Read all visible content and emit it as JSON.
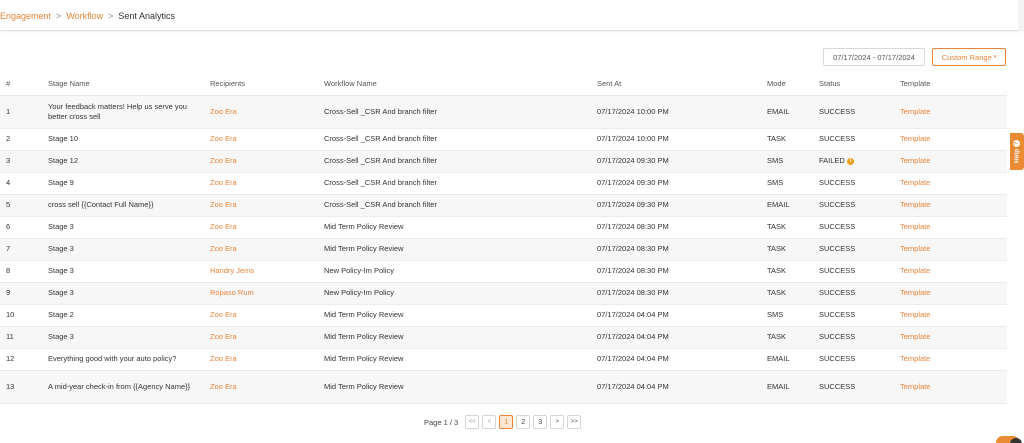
{
  "breadcrumb": {
    "engagement": "Engagement",
    "workflow": "Workflow",
    "current": "Sent Analytics",
    "separator": ">"
  },
  "filters": {
    "date_range": "07/17/2024 - 07/17/2024",
    "custom_range": "Custom Range"
  },
  "help": {
    "label": "Help",
    "icon": "question-icon"
  },
  "table": {
    "columns": [
      "#",
      "Stage Name",
      "Recipients",
      "Workflow Name",
      "Sent At",
      "Mode",
      "Status",
      "Template"
    ],
    "rows": [
      {
        "num": "1",
        "stage": "Your feedback matters! Help us serve you better cross sell",
        "recipient": "Zoo Era",
        "workflow": "Cross-Sell _CSR And branch filter",
        "sent_at": "07/17/2024 10:00 PM",
        "mode": "EMAIL",
        "status": "SUCCESS",
        "template": "Template"
      },
      {
        "num": "2",
        "stage": "Stage 10",
        "recipient": "Zoo Era",
        "workflow": "Cross-Sell _CSR And branch filter",
        "sent_at": "07/17/2024 10:00 PM",
        "mode": "TASK",
        "status": "SUCCESS",
        "template": "Template"
      },
      {
        "num": "3",
        "stage": "Stage 12",
        "recipient": "Zoo Era",
        "workflow": "Cross-Sell _CSR And branch filter",
        "sent_at": "07/17/2024 09:30 PM",
        "mode": "SMS",
        "status": "FAILED",
        "template": "Template"
      },
      {
        "num": "4",
        "stage": "Stage 9",
        "recipient": "Zoo Era",
        "workflow": "Cross-Sell _CSR And branch filter",
        "sent_at": "07/17/2024 09:30 PM",
        "mode": "SMS",
        "status": "SUCCESS",
        "template": "Template"
      },
      {
        "num": "5",
        "stage": "cross sell {{Contact Full Name}}",
        "recipient": "Zoo Era",
        "workflow": "Cross-Sell _CSR And branch filter",
        "sent_at": "07/17/2024 09:30 PM",
        "mode": "EMAIL",
        "status": "SUCCESS",
        "template": "Template"
      },
      {
        "num": "6",
        "stage": "Stage 3",
        "recipient": "Zoo Era",
        "workflow": "Mid Term Policy Review",
        "sent_at": "07/17/2024 08:30 PM",
        "mode": "TASK",
        "status": "SUCCESS",
        "template": "Template"
      },
      {
        "num": "7",
        "stage": "Stage 3",
        "recipient": "Zoo Era",
        "workflow": "Mid Term Policy Review",
        "sent_at": "07/17/2024 08:30 PM",
        "mode": "TASK",
        "status": "SUCCESS",
        "template": "Template"
      },
      {
        "num": "8",
        "stage": "Stage 3",
        "recipient": "Handry Jems",
        "workflow": "New Policy-Im Policy",
        "sent_at": "07/17/2024 08:30 PM",
        "mode": "TASK",
        "status": "SUCCESS",
        "template": "Template"
      },
      {
        "num": "9",
        "stage": "Stage 3",
        "recipient": "Ropaso Rum",
        "workflow": "New Policy-Im Policy",
        "sent_at": "07/17/2024 08:30 PM",
        "mode": "TASK",
        "status": "SUCCESS",
        "template": "Template"
      },
      {
        "num": "10",
        "stage": "Stage 2",
        "recipient": "Zoo Era",
        "workflow": "Mid Term Policy Review",
        "sent_at": "07/17/2024 04:04 PM",
        "mode": "SMS",
        "status": "SUCCESS",
        "template": "Template"
      },
      {
        "num": "11",
        "stage": "Stage 3",
        "recipient": "Zoo Era",
        "workflow": "Mid Term Policy Review",
        "sent_at": "07/17/2024 04:04 PM",
        "mode": "TASK",
        "status": "SUCCESS",
        "template": "Template"
      },
      {
        "num": "12",
        "stage": "Everything good with your auto policy?",
        "recipient": "Zoo Era",
        "workflow": "Mid Term Policy Review",
        "sent_at": "07/17/2024 04:04 PM",
        "mode": "EMAIL",
        "status": "SUCCESS",
        "template": "Template"
      },
      {
        "num": "13",
        "stage": "A mid-year check-in from {{Agency Name}}",
        "recipient": "Zoo Era",
        "workflow": "Mid Term Policy Review",
        "sent_at": "07/17/2024 04:04 PM",
        "mode": "EMAIL",
        "status": "SUCCESS",
        "template": "Template"
      }
    ]
  },
  "pagination": {
    "label": "Page 1 / 3",
    "first": "<<",
    "prev": "<",
    "pages": [
      "1",
      "2",
      "3"
    ],
    "active_page": "1",
    "next": ">",
    "last": ">>"
  },
  "colors": {
    "accent": "#e8843a",
    "failed_icon": "#f0a020"
  }
}
